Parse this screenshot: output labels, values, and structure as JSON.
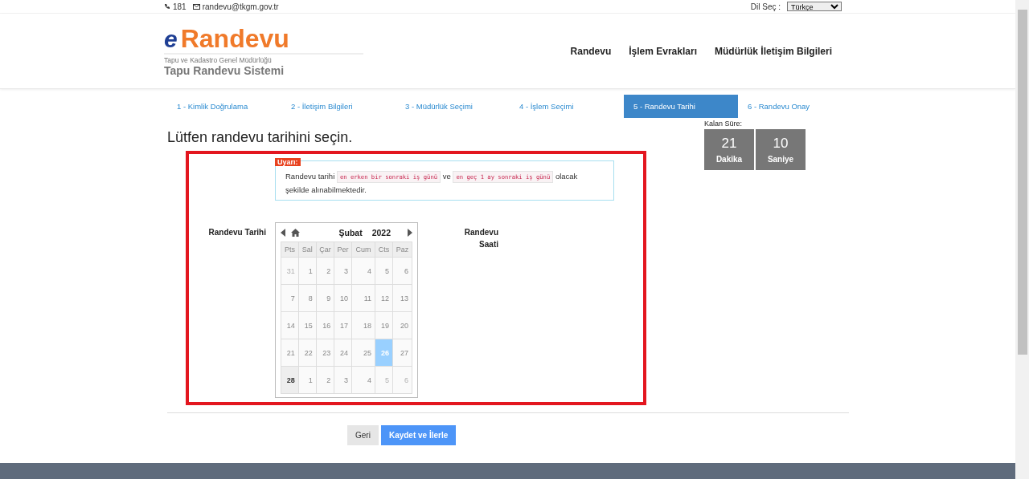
{
  "top_bar": {
    "phone": "181",
    "email": "randevu@tkgm.gov.tr",
    "language_label": "Dil Seç :",
    "language_value": "Türkçe"
  },
  "logo": {
    "letter": "e",
    "name": "Randevu",
    "subtitle": "Tapu ve Kadastro Genel Müdürlüğü",
    "system": "Tapu Randevu Sistemi"
  },
  "nav": [
    "Randevu",
    "İşlem Evrakları",
    "Müdürlük İletişim Bilgileri"
  ],
  "steps": [
    {
      "label": "1 - Kimlik Doğrulama",
      "selected": false
    },
    {
      "label": "2 - İletişim Bilgileri",
      "selected": false
    },
    {
      "label": "3 - Müdürlük Seçimi",
      "selected": false
    },
    {
      "label": "4 - İşlem Seçimi",
      "selected": false
    },
    {
      "label": "5 - Randevu Tarihi",
      "selected": true
    },
    {
      "label": "6 - Randevu Onay",
      "selected": false
    }
  ],
  "title": "Lütfen randevu tarihini seçin.",
  "warning": {
    "badge": "Uyarı:",
    "text_before": "Randevu tarihi",
    "code_1": "en erken bir sonraki iş günü",
    "text_middle": "ve",
    "code_2": "en geç 1 ay sonraki iş günü",
    "text_after": "olacak şekilde alınabilmektedir."
  },
  "date_label": "Randevu Tarihi",
  "time_label": "Randevu Saati",
  "calendar": {
    "month": "Şubat",
    "year": "2022",
    "weekdays": [
      "Pts",
      "Sal",
      "Çar",
      "Per",
      "Cum",
      "Cts",
      "Paz"
    ],
    "weeks": [
      [
        {
          "label": "31",
          "kind": "other",
          "selected": false
        },
        {
          "label": "1",
          "kind": "day",
          "selected": false
        },
        {
          "label": "2",
          "kind": "day",
          "selected": false
        },
        {
          "label": "3",
          "kind": "day",
          "selected": false
        },
        {
          "label": "4",
          "kind": "day",
          "selected": false
        },
        {
          "label": "5",
          "kind": "day",
          "selected": false
        },
        {
          "label": "6",
          "kind": "day",
          "selected": false
        }
      ],
      [
        {
          "label": "7",
          "kind": "day",
          "selected": false
        },
        {
          "label": "8",
          "kind": "day",
          "selected": false
        },
        {
          "label": "9",
          "kind": "day",
          "selected": false
        },
        {
          "label": "10",
          "kind": "day",
          "selected": false
        },
        {
          "label": "11",
          "kind": "day",
          "selected": false
        },
        {
          "label": "12",
          "kind": "day",
          "selected": false
        },
        {
          "label": "13",
          "kind": "day",
          "selected": false
        }
      ],
      [
        {
          "label": "14",
          "kind": "day",
          "selected": false
        },
        {
          "label": "15",
          "kind": "day",
          "selected": false
        },
        {
          "label": "16",
          "kind": "day",
          "selected": false
        },
        {
          "label": "17",
          "kind": "day",
          "selected": false
        },
        {
          "label": "18",
          "kind": "day",
          "selected": false
        },
        {
          "label": "19",
          "kind": "day",
          "selected": false
        },
        {
          "label": "20",
          "kind": "day",
          "selected": false
        }
      ],
      [
        {
          "label": "21",
          "kind": "day",
          "selected": false
        },
        {
          "label": "22",
          "kind": "day",
          "selected": false
        },
        {
          "label": "23",
          "kind": "day",
          "selected": false
        },
        {
          "label": "24",
          "kind": "day",
          "selected": false
        },
        {
          "label": "25",
          "kind": "day",
          "selected": false
        },
        {
          "label": "26",
          "kind": "day",
          "selected": true
        },
        {
          "label": "27",
          "kind": "day",
          "selected": false
        }
      ],
      [
        {
          "label": "28",
          "kind": "today",
          "selected": false
        },
        {
          "label": "1",
          "kind": "day",
          "selected": false
        },
        {
          "label": "2",
          "kind": "day",
          "selected": false
        },
        {
          "label": "3",
          "kind": "day",
          "selected": false
        },
        {
          "label": "4",
          "kind": "day",
          "selected": false
        },
        {
          "label": "5",
          "kind": "other",
          "selected": false
        },
        {
          "label": "6",
          "kind": "other",
          "selected": false
        }
      ]
    ]
  },
  "timer": {
    "label": "Kalan Süre:",
    "units": [
      {
        "value": "21",
        "unit": "Dakika"
      },
      {
        "value": "10",
        "unit": "Saniye"
      }
    ]
  },
  "buttons": [
    {
      "label": "Geri",
      "kind": "secondary"
    },
    {
      "label": "Kaydet ve İlerle",
      "kind": "primary"
    }
  ]
}
